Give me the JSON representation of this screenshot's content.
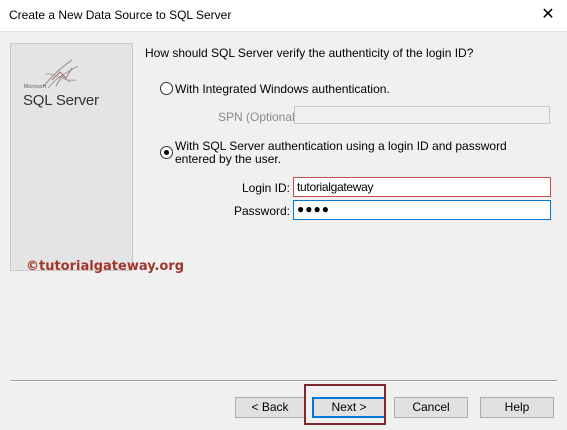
{
  "window": {
    "title": "Create a New Data Source to SQL Server",
    "close_symbol": "✕"
  },
  "side_panel": {
    "logo_small": "Microsoft",
    "logo_text": "SQL Server"
  },
  "watermark": "©tutorialgateway.org",
  "form": {
    "question": "How should SQL Server verify the authenticity of the login ID?",
    "option_windows": {
      "label": "With Integrated Windows authentication.",
      "selected": false
    },
    "spn_label": "SPN (Optional):",
    "spn_value": "",
    "option_sql": {
      "label": "With SQL Server authentication using a login ID and password entered by the user.",
      "selected": true
    },
    "login_label": "Login ID:",
    "login_value": "tutorialgateway",
    "password_label": "Password:",
    "password_masked": "●●●●"
  },
  "buttons": {
    "back": "< Back",
    "next": "Next >",
    "cancel": "Cancel",
    "help": "Help"
  },
  "colors": {
    "highlight_box": "#7b2831",
    "focus_border": "#0078d7",
    "watermark": "#a1362c"
  }
}
